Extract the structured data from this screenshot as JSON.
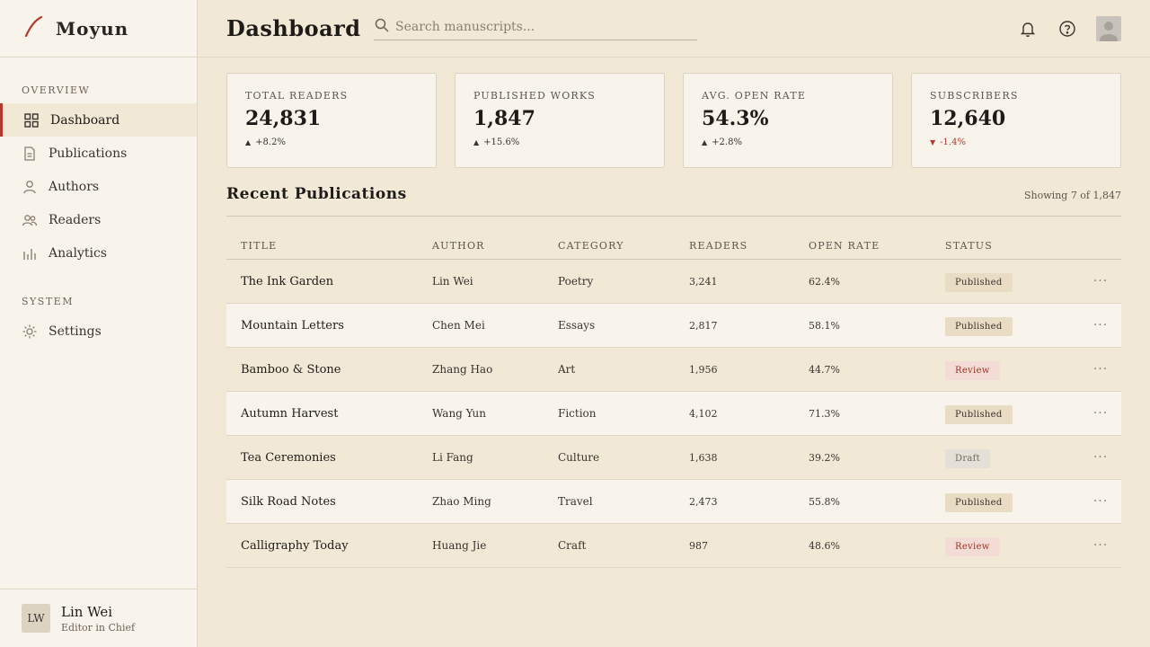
{
  "brand": {
    "name": "Moyun"
  },
  "sidebar": {
    "overview_label": "OVERVIEW",
    "system_label": "SYSTEM",
    "items": [
      {
        "label": "Dashboard",
        "icon": "grid-icon"
      },
      {
        "label": "Publications",
        "icon": "document-icon"
      },
      {
        "label": "Authors",
        "icon": "user-icon"
      },
      {
        "label": "Readers",
        "icon": "users-icon"
      },
      {
        "label": "Analytics",
        "icon": "bar-chart-icon"
      }
    ],
    "system_items": [
      {
        "label": "Settings",
        "icon": "gear-icon"
      }
    ],
    "user": {
      "initials": "LW",
      "name": "Lin Wei",
      "role": "Editor in Chief"
    }
  },
  "header": {
    "title": "Dashboard",
    "search_placeholder": "Search manuscripts..."
  },
  "stats": [
    {
      "label": "TOTAL READERS",
      "value": "24,831",
      "change": "+8.2%",
      "direction": "up"
    },
    {
      "label": "PUBLISHED WORKS",
      "value": "1,847",
      "change": "+15.6%",
      "direction": "up"
    },
    {
      "label": "AVG. OPEN RATE",
      "value": "54.3%",
      "change": "+2.8%",
      "direction": "up"
    },
    {
      "label": "SUBSCRIBERS",
      "value": "12,640",
      "change": "-1.4%",
      "direction": "down"
    }
  ],
  "recent": {
    "title": "Recent Publications",
    "showing": "Showing 7 of 1,847",
    "columns": [
      "TITLE",
      "AUTHOR",
      "CATEGORY",
      "READERS",
      "OPEN RATE",
      "STATUS"
    ],
    "rows": [
      {
        "title": "The Ink Garden",
        "author": "Lin Wei",
        "category": "Poetry",
        "readers": "3,241",
        "rate": "62.4%",
        "status": "Published"
      },
      {
        "title": "Mountain Letters",
        "author": "Chen Mei",
        "category": "Essays",
        "readers": "2,817",
        "rate": "58.1%",
        "status": "Published"
      },
      {
        "title": "Bamboo & Stone",
        "author": "Zhang Hao",
        "category": "Art",
        "readers": "1,956",
        "rate": "44.7%",
        "status": "Review"
      },
      {
        "title": "Autumn Harvest",
        "author": "Wang Yun",
        "category": "Fiction",
        "readers": "4,102",
        "rate": "71.3%",
        "status": "Published"
      },
      {
        "title": "Tea Ceremonies",
        "author": "Li Fang",
        "category": "Culture",
        "readers": "1,638",
        "rate": "39.2%",
        "status": "Draft"
      },
      {
        "title": "Silk Road Notes",
        "author": "Zhao Ming",
        "category": "Travel",
        "readers": "2,473",
        "rate": "55.8%",
        "status": "Published"
      },
      {
        "title": "Calligraphy Today",
        "author": "Huang Jie",
        "category": "Craft",
        "readers": "987",
        "rate": "48.6%",
        "status": "Review"
      }
    ]
  },
  "colors": {
    "accent": "#b33a2c",
    "background": "#f1e8d6",
    "panel": "#f8f4ec"
  }
}
